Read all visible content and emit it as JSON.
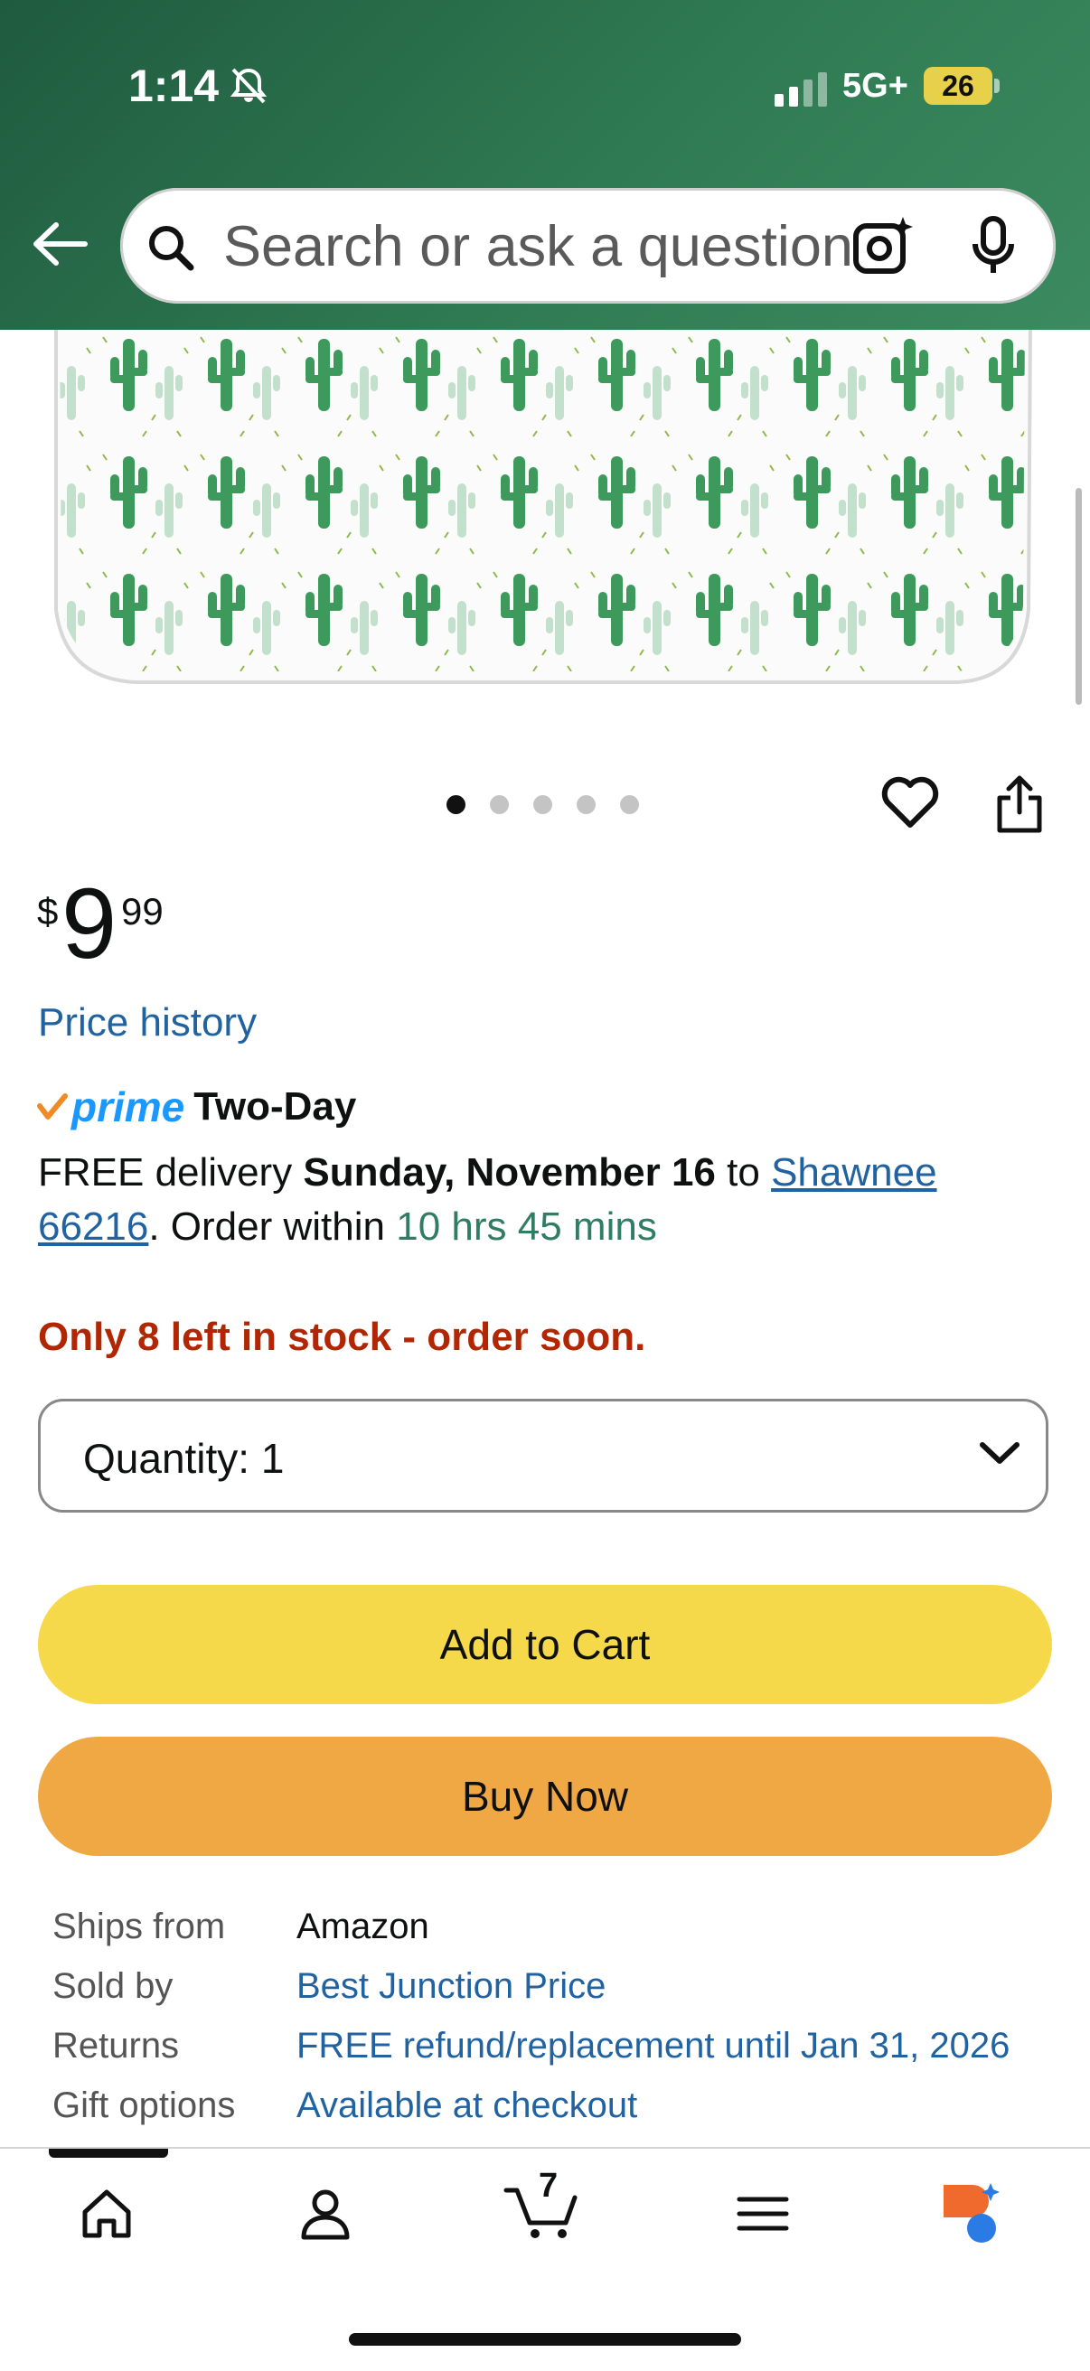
{
  "status": {
    "time": "1:14",
    "network": "5G+",
    "battery": "26"
  },
  "search": {
    "placeholder": "Search or ask a question"
  },
  "carousel": {
    "count": 5,
    "active": 0
  },
  "price": {
    "symbol": "$",
    "whole": "9",
    "fraction": "99"
  },
  "price_history_label": "Price history",
  "prime": {
    "word": "prime",
    "speed": "Two-Day"
  },
  "delivery": {
    "prefix": "FREE delivery",
    "date": "Sunday, November 16",
    "to": "to",
    "location_line1": "Shawnee",
    "location_line2": "66216",
    "order_within": ". Order within",
    "countdown": "10 hrs 45 mins"
  },
  "stock": "Only 8 left in stock - order soon.",
  "quantity": {
    "label": "Quantity:",
    "value": "1"
  },
  "buttons": {
    "add_to_cart": "Add to Cart",
    "buy_now": "Buy Now"
  },
  "details": [
    {
      "key": "Ships from",
      "value": "Amazon",
      "link": false
    },
    {
      "key": "Sold by",
      "value": "Best Junction Price",
      "link": true
    },
    {
      "key": "Returns",
      "value": "FREE refund/replacement until Jan 31, 2026",
      "link": true
    },
    {
      "key": "Gift options",
      "value": "Available at checkout",
      "link": true
    }
  ],
  "nav": {
    "cart_count": "7"
  },
  "colors": {
    "header": "#2f7a52",
    "add_to_cart": "#f6d94b",
    "buy_now": "#f0a844",
    "stock": "#b12704",
    "link": "#2162a1",
    "countdown": "#2f7d62"
  }
}
